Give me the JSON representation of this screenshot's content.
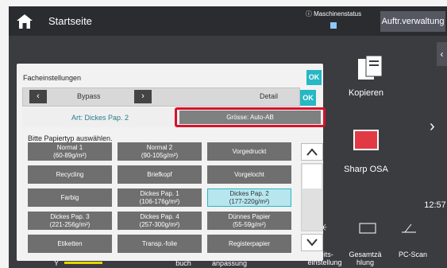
{
  "header": {
    "title": "Startseite",
    "status_label": "Maschinenstatus",
    "job_button": "Auftr.verwaltung"
  },
  "tiles": {
    "kopieren": "Kopieren",
    "sharp_osa": "Sharp OSA",
    "time": "12:57"
  },
  "bottom_bar": {
    "item1": "buch",
    "item2": "anpassung",
    "item3": "keits-\neinstellung",
    "item4": "Gesamtzä\nhlung",
    "item5": "PC-Scan",
    "y_label": "Y"
  },
  "dialog": {
    "title": "Facheinstellungen",
    "ok": "OK",
    "tray": "Bypass",
    "detail": "Detail",
    "art": "Art: Dickes Pap. 2",
    "size": "Grösse: Auto-AB",
    "prompt": "Bitte Papiertyp auswählen.",
    "options": [
      {
        "line1": "Normal 1",
        "line2": "(60-89g/m²)"
      },
      {
        "line1": "Normal 2",
        "line2": "(90-105g/m²)"
      },
      {
        "line1": "Vorgedruckt",
        "line2": ""
      },
      {
        "line1": "Recycling",
        "line2": ""
      },
      {
        "line1": "Briefkopf",
        "line2": ""
      },
      {
        "line1": "Vorgelocht",
        "line2": ""
      },
      {
        "line1": "Farbig",
        "line2": ""
      },
      {
        "line1": "Dickes Pap. 1",
        "line2": "(106-176g/m²)"
      },
      {
        "line1": "Dickes Pap. 2",
        "line2": "(177-220g/m²)"
      },
      {
        "line1": "Dickes Pap. 3",
        "line2": "(221-256g/m²)"
      },
      {
        "line1": "Dickes Pap. 4",
        "line2": "(257-300g/m²)"
      },
      {
        "line1": "Dünnes Papier",
        "line2": "(55-59g/m²)"
      },
      {
        "line1": "Etiketten",
        "line2": ""
      },
      {
        "line1": "Transp.-folie",
        "line2": ""
      },
      {
        "line1": "Registerpapier",
        "line2": ""
      }
    ]
  },
  "colors": {
    "accent": "#27b7c5",
    "highlight": "#d8112a"
  }
}
